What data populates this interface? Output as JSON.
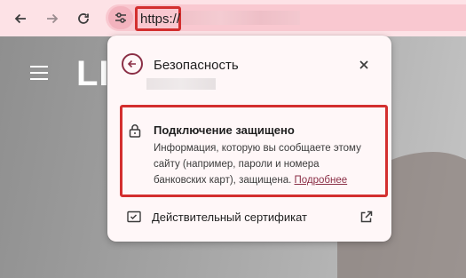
{
  "browser": {
    "url_scheme": "https://"
  },
  "page": {
    "logo_text": "LI"
  },
  "popup": {
    "title": "Безопасность",
    "connection": {
      "title": "Подключение защищено",
      "description": "Информация, которую вы сообщаете этому сайту (например, пароли и номера банковских карт), защищена.",
      "more_link": "Подробнее"
    },
    "certificate_label": "Действительный сертификат"
  },
  "icons": {
    "back": "arrow-left-icon",
    "forward": "arrow-right-icon",
    "reload": "reload-icon",
    "site_info": "tune-icon",
    "popup_back": "back-circle-icon",
    "close": "close-icon",
    "lock": "lock-icon",
    "certificate": "certificate-icon",
    "external": "external-link-icon"
  },
  "colors": {
    "toolbar_bg": "#fde2e6",
    "omnibox_bg": "#f9c8d0",
    "highlight_border": "#d32f2f",
    "link": "#8b2f46",
    "popup_bg": "#fff7f8"
  }
}
